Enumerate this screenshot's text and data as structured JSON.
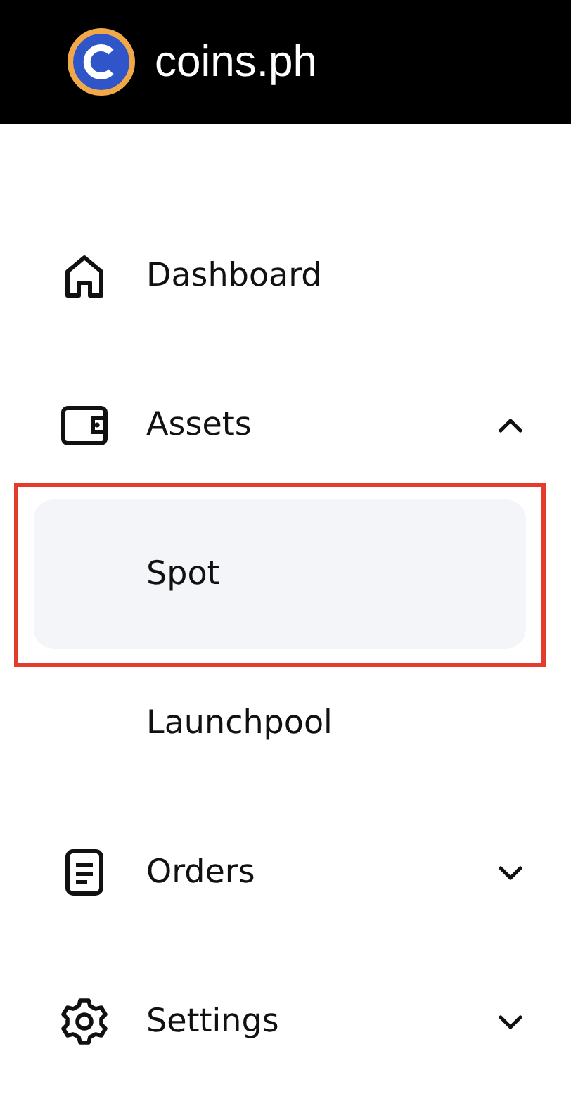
{
  "header": {
    "logo_text": "coins.ph"
  },
  "nav": {
    "items": [
      {
        "label": "Dashboard"
      },
      {
        "label": "Assets",
        "expanded": true,
        "children": [
          {
            "label": "Spot",
            "selected": true,
            "highlighted": true
          },
          {
            "label": "Launchpool",
            "selected": false,
            "highlighted": false
          }
        ]
      },
      {
        "label": "Orders",
        "expanded": false
      },
      {
        "label": "Settings",
        "expanded": false
      }
    ]
  }
}
